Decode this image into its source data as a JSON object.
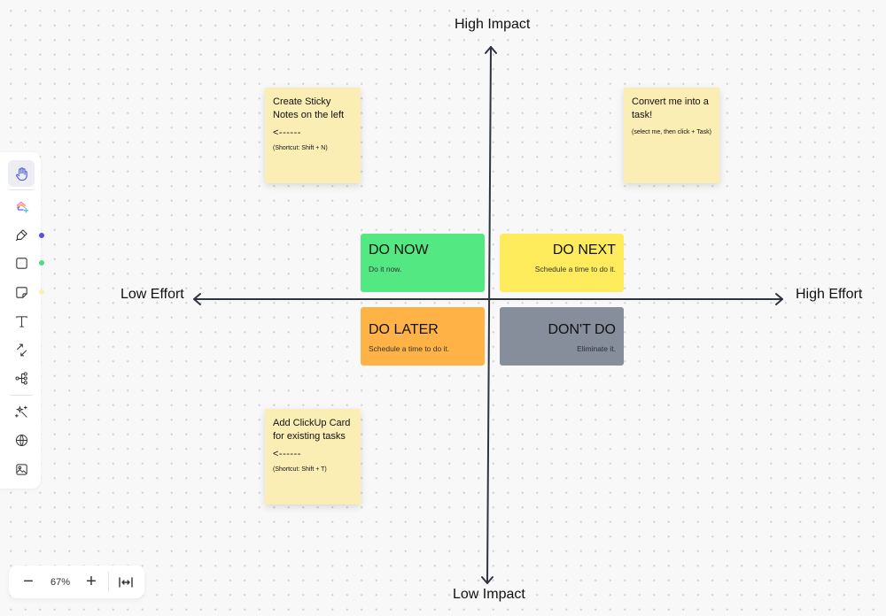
{
  "canvas": {
    "axes": {
      "top_label": "High Impact",
      "bottom_label": "Low Impact",
      "left_label": "Low Effort",
      "right_label": "High Effort"
    },
    "quadrants": [
      {
        "title": "DO NOW",
        "subtitle": "Do it now.",
        "color": "#54e882"
      },
      {
        "title": "DO NEXT",
        "subtitle": "Schedule a time to do it.",
        "color": "#ffec5c"
      },
      {
        "title": "DO LATER",
        "subtitle": "Schedule a time to do it.",
        "color": "#ffb347"
      },
      {
        "title": "DON'T DO",
        "subtitle": "Eliminate it.",
        "color": "#868e9b"
      }
    ],
    "stickies": [
      {
        "title": "Create Sticky Notes on the left",
        "arrow": "<------",
        "hint": "(Shortcut: Shift + N)"
      },
      {
        "title": "Convert me into a task!",
        "hint": "(select me, then click + Task)"
      },
      {
        "title": "Add ClickUp Card for existing tasks",
        "arrow": "<------",
        "hint": "(Shortcut: Shift + T)"
      }
    ]
  },
  "toolbar": {
    "tools": [
      {
        "name": "hand",
        "icon": "hand-icon",
        "active": true
      },
      {
        "name": "clickup-ai",
        "icon": "clickup-add-icon"
      },
      {
        "name": "pen",
        "icon": "pen-icon",
        "dot_color": "#5b4de8"
      },
      {
        "name": "shape",
        "icon": "square-icon",
        "dot_color": "#4ade80"
      },
      {
        "name": "sticky",
        "icon": "sticky-note-icon",
        "dot_color": "#fbeeb4"
      },
      {
        "name": "text",
        "icon": "text-icon"
      },
      {
        "name": "connector",
        "icon": "connector-icon"
      },
      {
        "name": "mind-map",
        "icon": "mind-map-icon"
      },
      {
        "name": "ai-magic",
        "icon": "magic-wand-icon"
      },
      {
        "name": "embed",
        "icon": "globe-icon"
      },
      {
        "name": "image",
        "icon": "image-icon"
      }
    ]
  },
  "zoom": {
    "value": "67%",
    "minus": "−",
    "plus": "+",
    "fit_icon": "fit-width-icon"
  }
}
